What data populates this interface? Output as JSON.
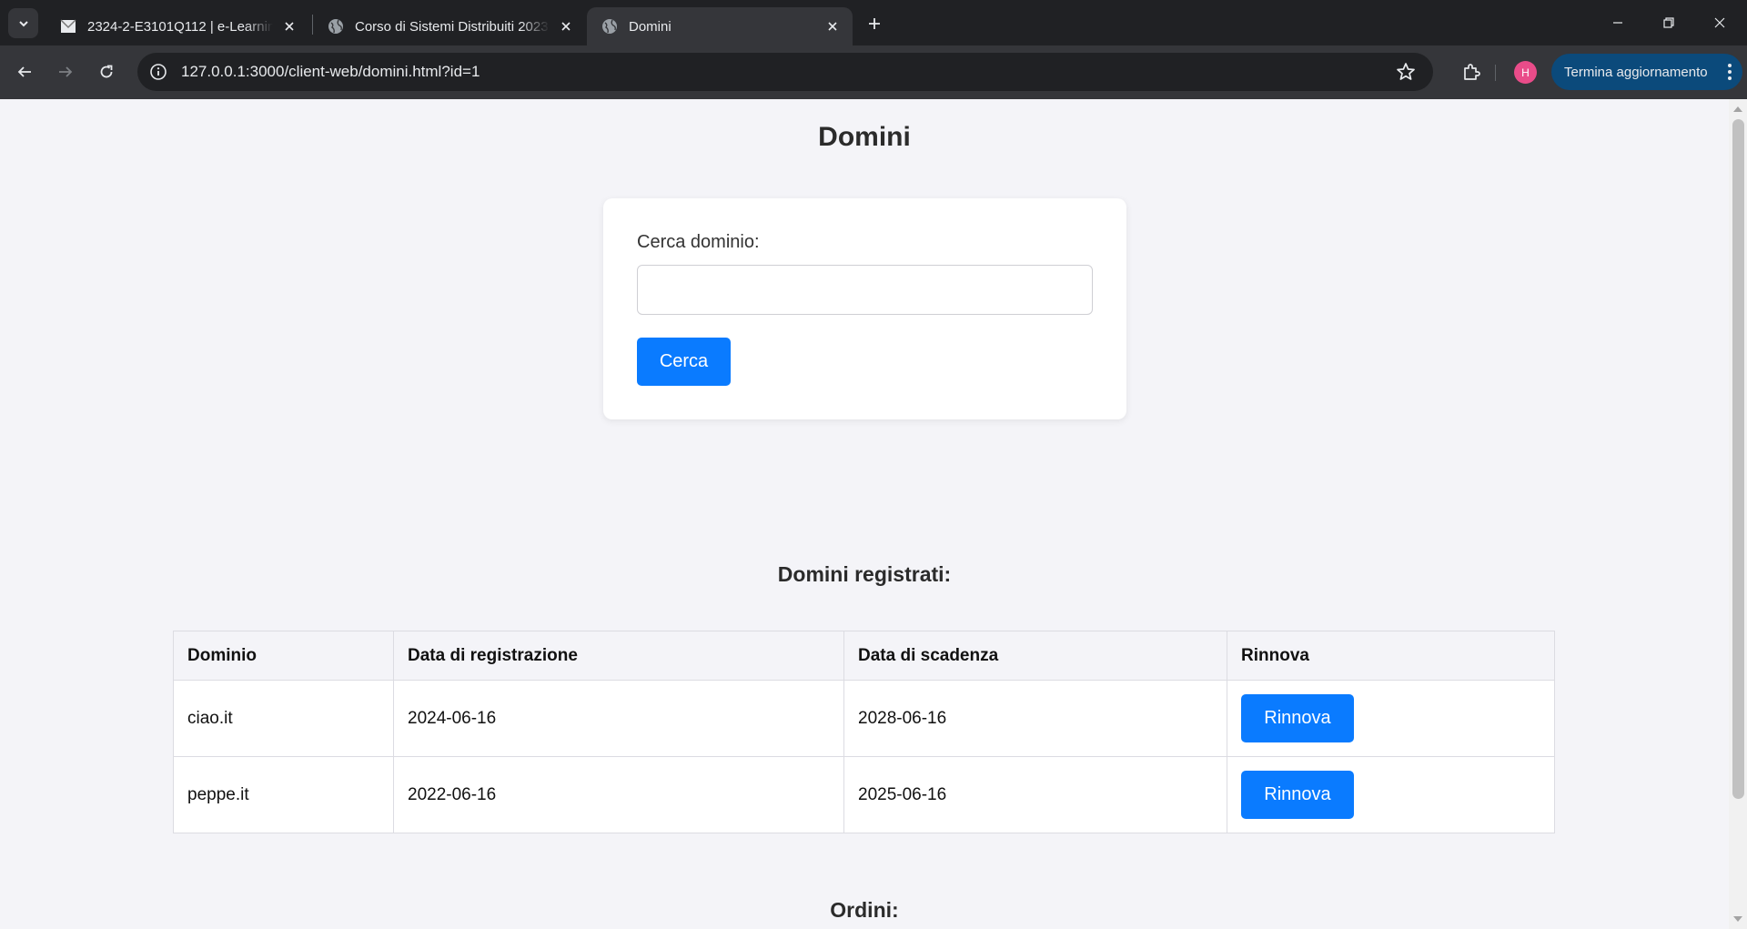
{
  "browser": {
    "tabs": [
      {
        "title": "2324-2-E3101Q112 | e-Learning",
        "active": false
      },
      {
        "title": "Corso di Sistemi Distribuiti 2023",
        "active": false
      },
      {
        "title": "Domini",
        "active": true
      }
    ],
    "url": "127.0.0.1:3000/client-web/domini.html?id=1",
    "profile_initial": "H",
    "update_label": "Termina aggiornamento"
  },
  "page": {
    "title": "Domini",
    "search": {
      "label": "Cerca dominio:",
      "value": "",
      "placeholder": "",
      "button_label": "Cerca"
    },
    "registered": {
      "title": "Domini registrati:",
      "columns": [
        "Dominio",
        "Data di registrazione",
        "Data di scadenza",
        "Rinnova"
      ],
      "rows": [
        {
          "domain": "ciao.it",
          "registered": "2024-06-16",
          "expires": "2028-06-16",
          "action": "Rinnova"
        },
        {
          "domain": "peppe.it",
          "registered": "2022-06-16",
          "expires": "2025-06-16",
          "action": "Rinnova"
        }
      ]
    },
    "orders": {
      "title": "Ordini:"
    }
  },
  "colors": {
    "accent": "#0a7bff",
    "page_bg": "#f4f4f8",
    "chrome_dark": "#202124",
    "chrome_toolbar": "#35363a",
    "profile": "#e94c89",
    "update_button": "#0b4a7b"
  }
}
